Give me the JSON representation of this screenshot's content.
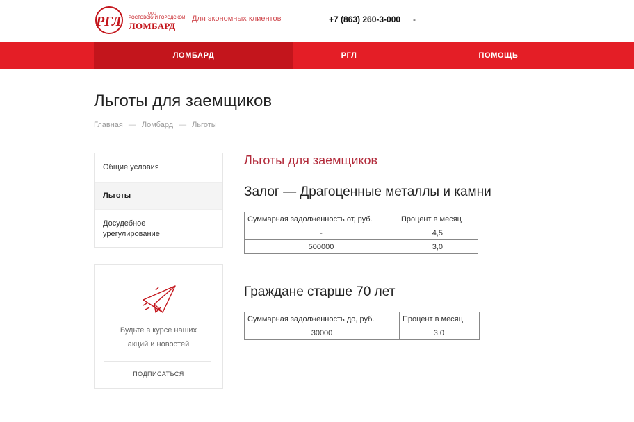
{
  "header": {
    "logo": {
      "monogram": "РГЛ",
      "small_top": "ООО",
      "small": "РОСТОВСКИЙ ГОРОДСКОЙ",
      "big": "ЛОМБАРД"
    },
    "tagline": "Для экономных клиентов",
    "phone": "+7 (863) 260-3-000",
    "phone_suffix": "-"
  },
  "nav": {
    "items": [
      {
        "label": "ЛОМБАРД",
        "active": true
      },
      {
        "label": "РГЛ",
        "active": false
      },
      {
        "label": "ПОМОЩЬ",
        "active": false
      }
    ]
  },
  "page": {
    "title": "Льготы для заемщиков",
    "breadcrumb": [
      "Главная",
      "Ломбард",
      "Льготы"
    ],
    "breadcrumb_sep": "—"
  },
  "sidebar": {
    "items": [
      {
        "label": "Общие условия"
      },
      {
        "label": "Льготы"
      },
      {
        "label": "Досудебное урегулирование"
      }
    ]
  },
  "subscribe": {
    "icon": "paper-plane-icon",
    "text_line1": "Будьте в курсе наших",
    "text_line2": "акций и новостей",
    "link": "ПОДПИСАТЬСЯ"
  },
  "content": {
    "section_title": "Льготы для заемщиков",
    "block1": {
      "heading": "Залог — Драгоценные металлы и камни",
      "headers": [
        "Суммарная задолженность от, руб.",
        "Процент в месяц"
      ],
      "rows": [
        [
          "-",
          "4,5"
        ],
        [
          "500000",
          "3,0"
        ]
      ]
    },
    "block2": {
      "heading": "Граждане старше 70 лет",
      "headers": [
        "Суммарная задолженность до, руб.",
        "Процент в месяц"
      ],
      "rows": [
        [
          "30000",
          "3,0"
        ]
      ]
    }
  },
  "colors": {
    "brand_red": "#e41e26",
    "brand_red_dark": "#c3151c",
    "section_title": "#b22a3a"
  }
}
